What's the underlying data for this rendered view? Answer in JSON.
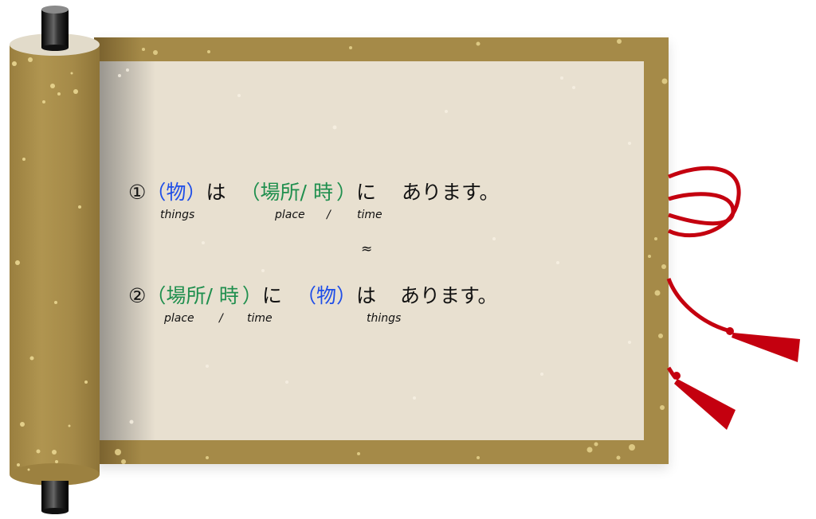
{
  "sentence1": {
    "number": "①",
    "thing_open": "（",
    "thing": "物",
    "thing_close": "）",
    "particle_wa": "は",
    "place_open": "（",
    "place": "場所",
    "slash": "/",
    "time": "時",
    "place_close": "）",
    "particle_ni": "に",
    "verb": "あります。",
    "gloss_things": "things",
    "gloss_place": "place",
    "gloss_slash": "/",
    "gloss_time": "time"
  },
  "approx_symbol": "≈",
  "sentence2": {
    "number": "②",
    "place_open": "（",
    "place": "場所",
    "slash": "/",
    "time": "時",
    "place_close": "）",
    "particle_ni": "に",
    "thing_open": "（",
    "thing": "物",
    "thing_close": "）",
    "particle_wa": "は",
    "verb": "あります。",
    "gloss_place": "place",
    "gloss_slash": "/",
    "gloss_time": "time",
    "gloss_things": "things"
  },
  "colors": {
    "frame_gold": "#a58a48",
    "paper": "#e8e0d0",
    "thing_blue": "#1f4ee8",
    "place_green": "#1f8f4e",
    "cord_red": "#c4000f"
  }
}
